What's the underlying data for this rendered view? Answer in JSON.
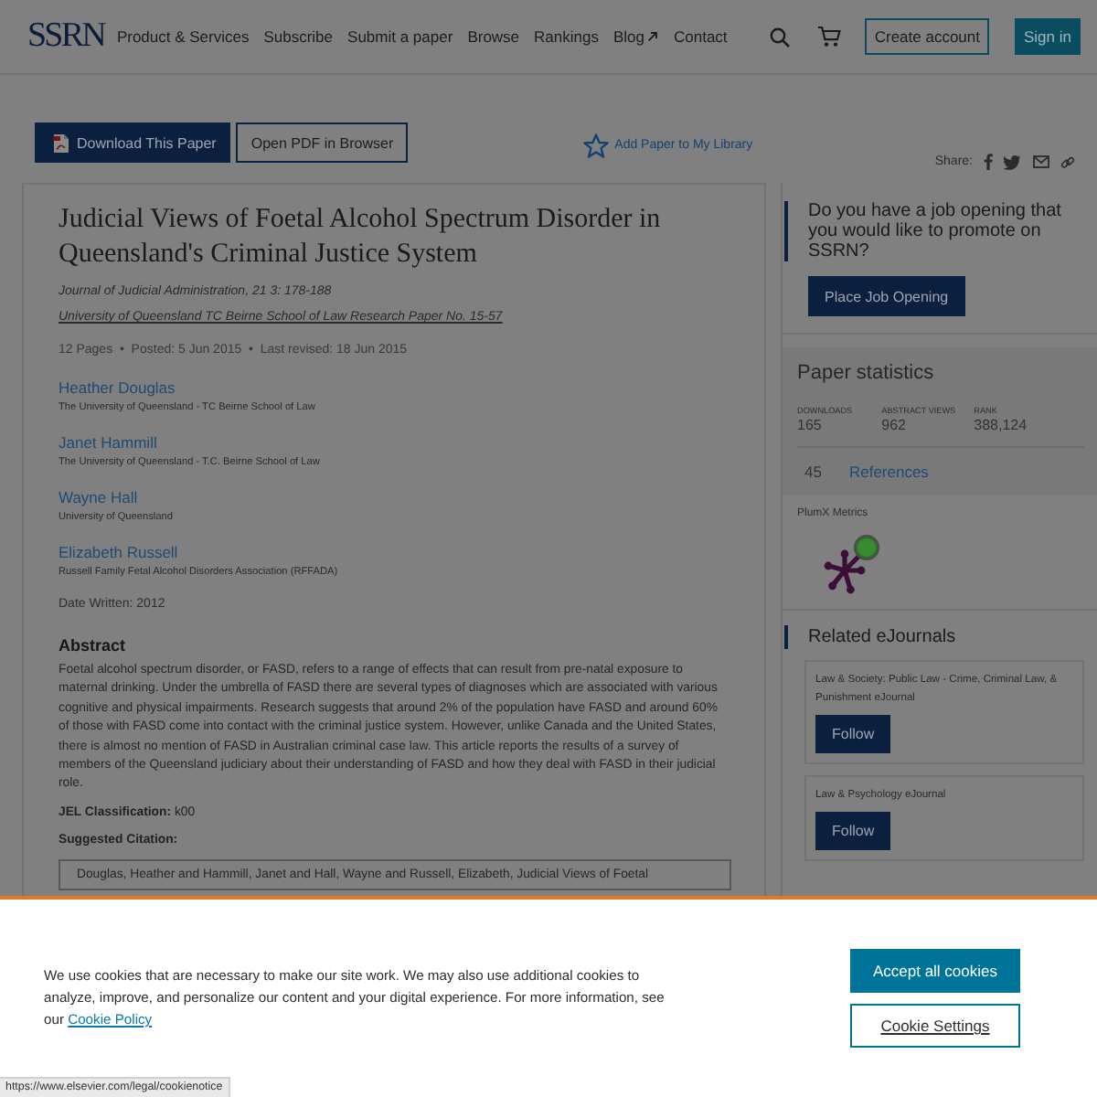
{
  "nav": {
    "logo": "SSRN",
    "links": [
      {
        "label": "Product & Services",
        "kind": "internal"
      },
      {
        "label": "Subscribe",
        "kind": "internal"
      },
      {
        "label": "Submit a paper",
        "kind": "internal"
      },
      {
        "label": "Browse",
        "kind": "internal"
      },
      {
        "label": "Rankings",
        "kind": "internal"
      },
      {
        "label": "Blog",
        "kind": "external"
      },
      {
        "label": "Contact",
        "kind": "internal"
      }
    ],
    "create_account": "Create account",
    "sign_in": "Sign in"
  },
  "toolbar": {
    "download": "Download This Paper",
    "open_pdf": "Open PDF in Browser",
    "add_library": "Add Paper to My Library",
    "share_label": "Share:"
  },
  "paper": {
    "title": "Judicial Views of Foetal Alcohol Spectrum Disorder in Queensland's Criminal Justice System",
    "journal": "Journal of Judicial Administration, 21 3: 178-188",
    "series": "University of Queensland TC Beirne School of Law Research Paper No. 15-57",
    "meta": "12 Pages  •  Posted: 5 Jun 2015  •  Last revised: 18 Jun 2015",
    "authors": [
      {
        "name": "Heather Douglas",
        "affiliation": "The University of Queensland - TC Beirne School of Law"
      },
      {
        "name": "Janet Hammill",
        "affiliation": "The University of Queensland - T.C. Beirne School of Law"
      },
      {
        "name": "Wayne Hall",
        "affiliation": "University of Queensland"
      },
      {
        "name": "Elizabeth Russell",
        "affiliation": "Russell Family Fetal Alcohol Disorders Association (RFFADA)"
      }
    ],
    "date_written": "Date Written: 2012",
    "abstract_heading": "Abstract",
    "abstract": "Foetal alcohol spectrum disorder, or FASD, refers to a range of effects that can result from pre-natal exposure to maternal drinking. Under the umbrella of FASD there are several types of diagnoses which are associated with various cognitive and physical impairments. Research suggests that around 2% of the population have FASD and around 60% of those with FASD come into contact with the criminal justice system. However, unlike Canada and the United States, there is almost no mention of FASD in Australian criminal case law. This article reports the results of a survey of members of the Queensland judiciary about their understanding of FASD and how they deal with FASD in their judicial role.",
    "jel": "**JEL Classification:** k00",
    "citation_heading": "Suggested Citation:",
    "citation": "Douglas, Heather and Hammill, Janet and Hall, Wayne and Russell, Elizabeth, Judicial Views of Foetal"
  },
  "sidebar": {
    "job": {
      "question": "Do you have a job opening that you would like to promote on SSRN?",
      "button": "Place Job Opening"
    },
    "stats": {
      "title": "Paper statistics",
      "items": [
        {
          "label": "DOWNLOADS",
          "value": "165"
        },
        {
          "label": "ABSTRACT VIEWS",
          "value": "962"
        },
        {
          "label": "RANK",
          "value": "388,124"
        }
      ],
      "references_count": "45",
      "references_label": "References"
    },
    "plumx_label": "PlumX Metrics",
    "related": {
      "title": "Related eJournals",
      "journals": [
        {
          "name": "Law & Society: Public Law - Crime, Criminal Law, & Punishment eJournal",
          "button": "Follow"
        },
        {
          "name": "Law & Psychology eJournal",
          "button": "Follow"
        }
      ]
    }
  },
  "cookie_banner": {
    "text": "We use cookies that are necessary to make our site work. We may also use additional cookies to analyze, improve, and personalize our content and your digital experience. For more information, see our",
    "link": "Cookie Policy",
    "accept": "Accept all cookies",
    "settings": "Cookie Settings"
  },
  "status_url": "https://www.elsevier.com/legal/cookienotice"
}
